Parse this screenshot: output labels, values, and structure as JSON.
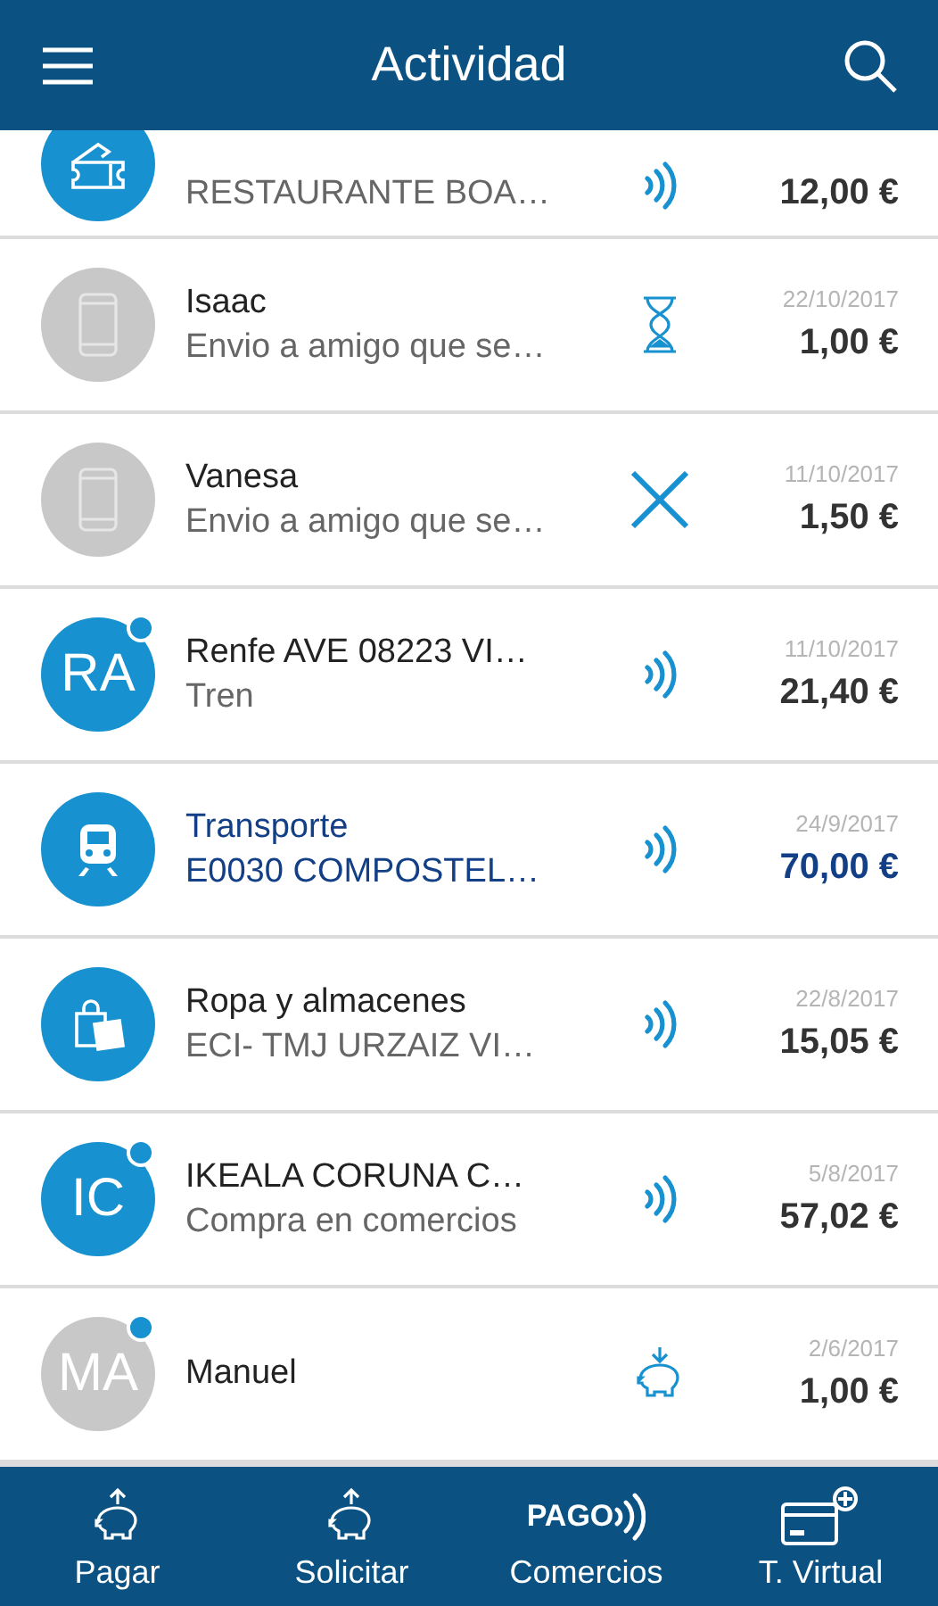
{
  "header": {
    "title": "Actividad"
  },
  "rows": [
    {
      "avatar": {
        "kind": "ticket",
        "gray": false
      },
      "dot": false,
      "subtitle": "RESTAURANTE BOA…",
      "status": {
        "kind": "contactless"
      },
      "amount": "12,00 €",
      "highlighted": false
    },
    {
      "avatar": {
        "kind": "phone",
        "gray": true
      },
      "dot": false,
      "title": "Isaac",
      "subtitle": "Envio a amigo que se…",
      "status": {
        "kind": "pending"
      },
      "date": "22/10/2017",
      "amount": "1,00 €",
      "highlighted": false
    },
    {
      "avatar": {
        "kind": "phone",
        "gray": true
      },
      "dot": false,
      "title": "Vanesa",
      "subtitle": "Envio a amigo que se…",
      "status": {
        "kind": "cancelled"
      },
      "date": "11/10/2017",
      "amount": "1,50 €",
      "highlighted": false
    },
    {
      "avatar": {
        "kind": "initials",
        "text": "RA",
        "gray": false
      },
      "dot": true,
      "title": "Renfe AVE 08223 VI…",
      "subtitle": "Tren",
      "status": {
        "kind": "contactless"
      },
      "date": "11/10/2017",
      "amount": "21,40 €",
      "highlighted": false
    },
    {
      "avatar": {
        "kind": "train",
        "gray": false
      },
      "dot": false,
      "title": "Transporte",
      "subtitle": "E0030 COMPOSTEL…",
      "status": {
        "kind": "contactless"
      },
      "date": "24/9/2017",
      "amount": "70,00 €",
      "highlighted": true
    },
    {
      "avatar": {
        "kind": "bags",
        "gray": false
      },
      "dot": false,
      "title": "Ropa y almacenes",
      "subtitle": "ECI- TMJ URZAIZ VI…",
      "status": {
        "kind": "contactless"
      },
      "date": "22/8/2017",
      "amount": "15,05 €",
      "highlighted": false
    },
    {
      "avatar": {
        "kind": "initials",
        "text": "IC",
        "gray": false
      },
      "dot": true,
      "title": "IKEALA CORUNA C…",
      "subtitle": "Compra en comercios",
      "status": {
        "kind": "contactless"
      },
      "date": "5/8/2017",
      "amount": "57,02 €",
      "highlighted": false
    },
    {
      "avatar": {
        "kind": "initials",
        "text": "MA",
        "gray": true
      },
      "dot": true,
      "title": "Manuel",
      "status": {
        "kind": "request"
      },
      "date": "2/6/2017",
      "amount": "1,00 €",
      "highlighted": false
    }
  ],
  "tabs": [
    {
      "kind": "pay",
      "label": "Pagar"
    },
    {
      "kind": "request",
      "label": "Solicitar"
    },
    {
      "kind": "pago",
      "label": "Comercios",
      "logo": "PAGO"
    },
    {
      "kind": "card",
      "label": "T. Virtual"
    }
  ]
}
